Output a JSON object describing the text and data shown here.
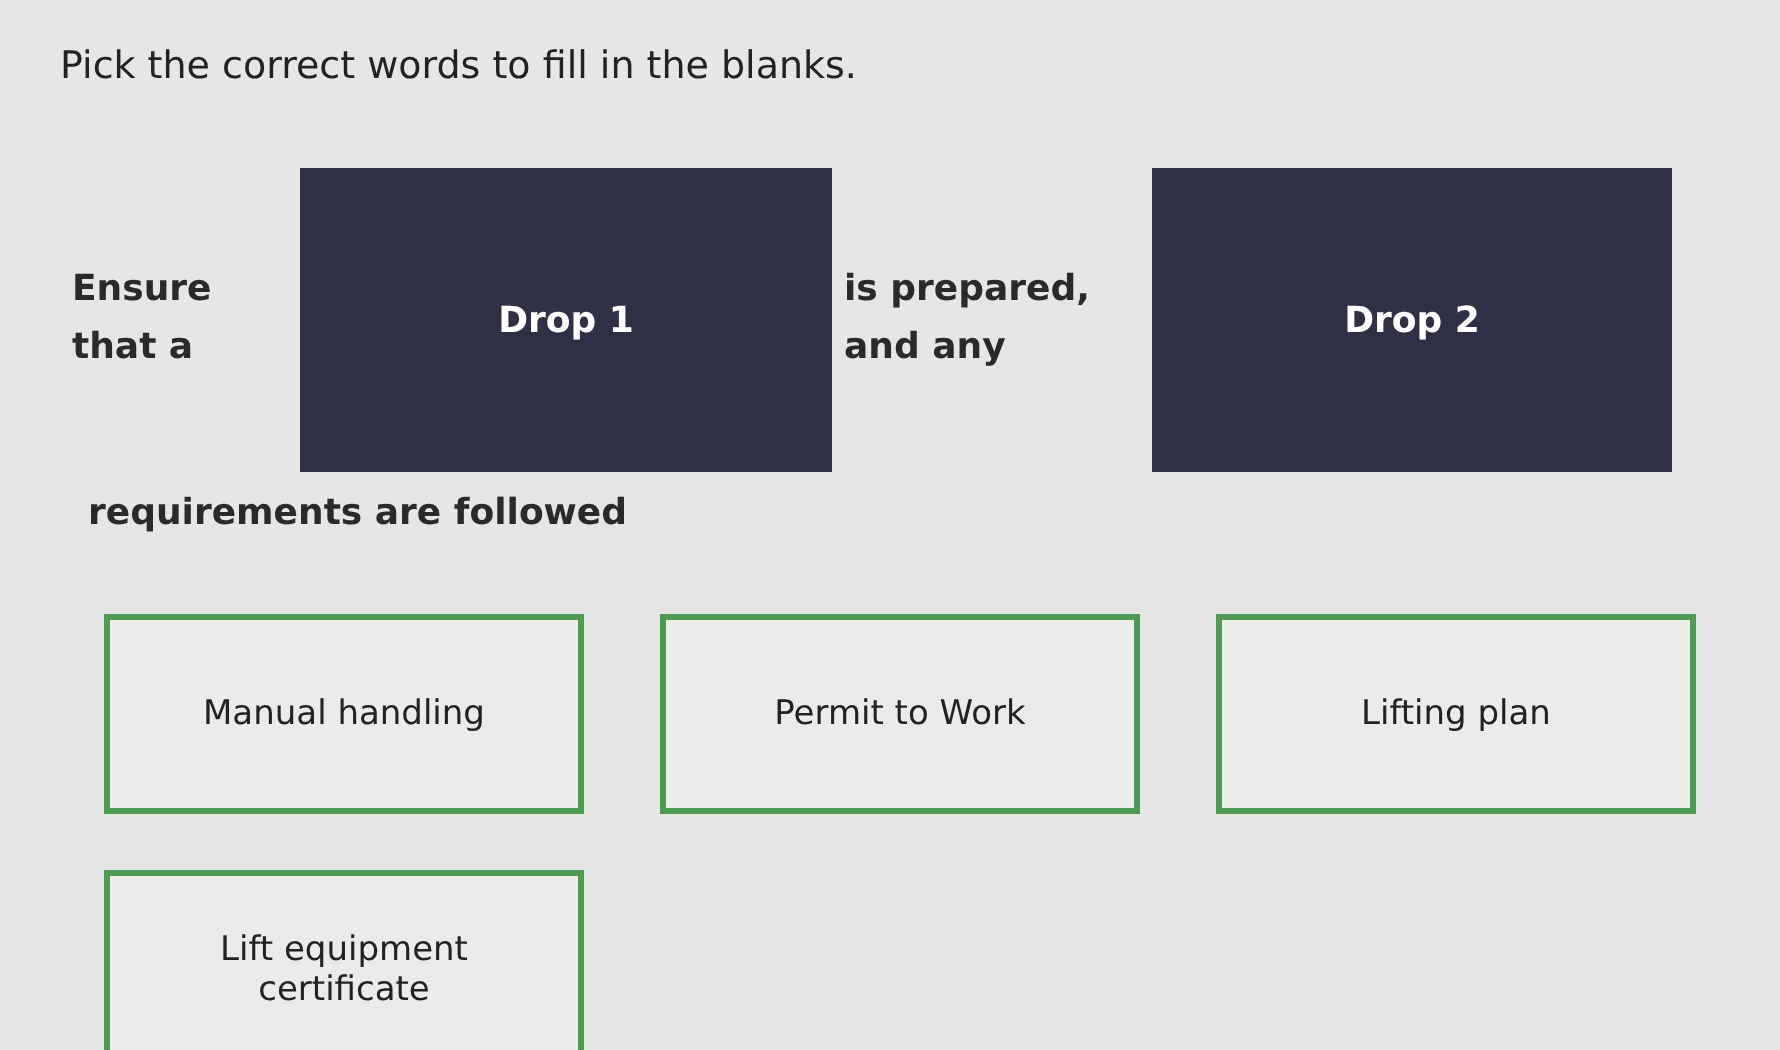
{
  "instruction": "Pick the correct words to fill in the blanks.",
  "sentence": [
    {
      "kind": "text",
      "text": "Ensure that a"
    },
    {
      "kind": "drop",
      "text": "Drop 1"
    },
    {
      "kind": "text",
      "text": "is prepared, and any"
    },
    {
      "kind": "drop",
      "text": "Drop 2"
    }
  ],
  "sentence_end": "requirements are followed",
  "options": [
    {
      "label": "Manual handling"
    },
    {
      "label": "Permit to Work"
    },
    {
      "label": "Lifting plan"
    },
    {
      "label": "Lift equipment certificate"
    }
  ]
}
